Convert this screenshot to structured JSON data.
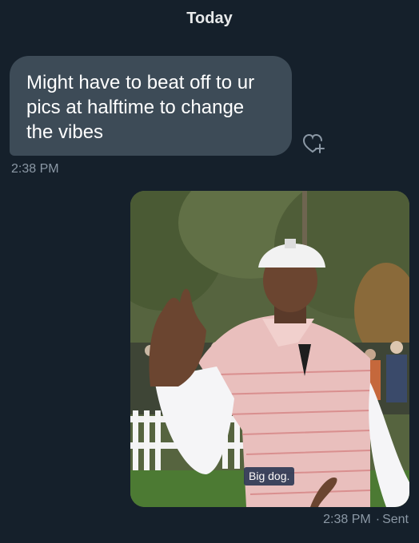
{
  "header": {
    "date_label": "Today"
  },
  "messages": [
    {
      "direction": "received",
      "text": "Might have to beat off to ur pics at halftime to change the vibes",
      "timestamp": "2:38 PM",
      "reaction_icon": "heart-plus-icon"
    },
    {
      "direction": "sent",
      "type": "image",
      "caption": "Big dog.",
      "timestamp": "2:38 PM",
      "status": "Sent"
    }
  ],
  "colors": {
    "background": "#15202b",
    "received_bubble": "#3d4b57",
    "meta_text": "#8b98a5"
  }
}
